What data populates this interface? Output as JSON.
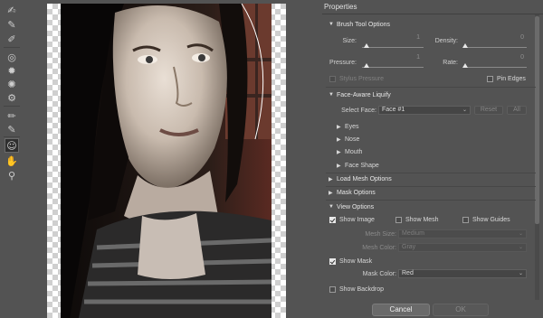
{
  "panel": {
    "title": "Properties"
  },
  "brush_tool_options": {
    "header": "Brush Tool Options",
    "size_label": "Size:",
    "size_value": "1",
    "density_label": "Density:",
    "density_value": "0",
    "pressure_label": "Pressure:",
    "pressure_value": "1",
    "rate_label": "Rate:",
    "rate_value": "0",
    "stylus_pressure_label": "Stylus Pressure",
    "pin_edges_label": "Pin Edges"
  },
  "face_aware": {
    "header": "Face-Aware Liquify",
    "select_face_label": "Select Face:",
    "select_face_value": "Face #1",
    "reset_label": "Reset",
    "all_label": "All",
    "items": [
      "Eyes",
      "Nose",
      "Mouth",
      "Face Shape"
    ]
  },
  "load_mesh": {
    "header": "Load Mesh Options"
  },
  "mask_options": {
    "header": "Mask Options"
  },
  "view_options": {
    "header": "View Options",
    "show_image_label": "Show Image",
    "show_mesh_label": "Show Mesh",
    "show_guides_label": "Show Guides",
    "mesh_size_label": "Mesh Size:",
    "mesh_size_value": "Medium",
    "mesh_color_label": "Mesh Color:",
    "mesh_color_value": "Gray",
    "show_mask_label": "Show Mask",
    "mask_color_label": "Mask Color:",
    "mask_color_value": "Red",
    "show_backdrop_label": "Show Backdrop"
  },
  "footer": {
    "cancel_label": "Cancel",
    "ok_label": "OK"
  },
  "tools": [
    "forward-warp-icon",
    "reconstruct-icon",
    "smooth-icon",
    "twirl-icon",
    "pucker-icon",
    "bloat-icon",
    "push-left-icon",
    "freeze-mask-icon",
    "thaw-mask-icon",
    "face-tool-icon",
    "hand-icon",
    "zoom-icon"
  ],
  "colors": {
    "panel_bg": "#535353",
    "canvas_checker": "#cfcfcf"
  }
}
